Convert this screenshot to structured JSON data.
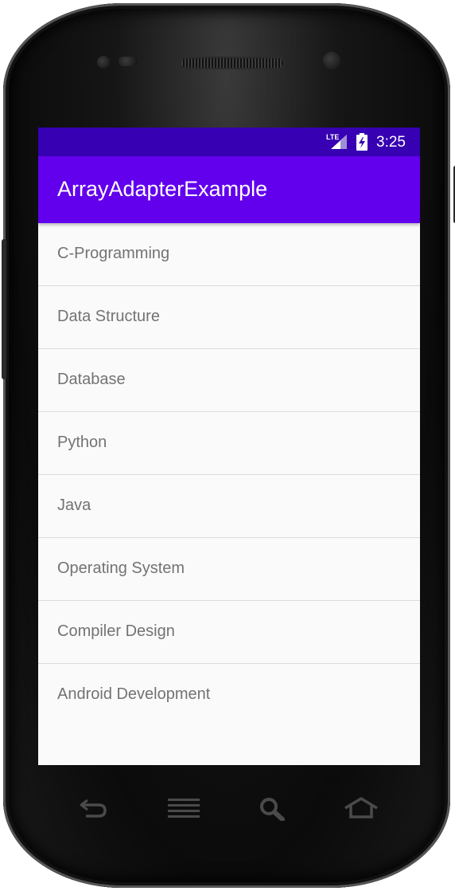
{
  "status_bar": {
    "network": "LTE",
    "time": "3:25"
  },
  "app_bar": {
    "title": "ArrayAdapterExample"
  },
  "list": {
    "items": [
      "C-Programming",
      "Data Structure",
      "Database",
      "Python",
      "Java",
      "Operating System",
      "Compiler Design",
      "Android Development"
    ]
  },
  "nav_bar": {
    "icons": [
      "back-icon",
      "menu-icon",
      "search-icon",
      "home-icon"
    ]
  },
  "colors": {
    "status_bar": "#3700b3",
    "app_bar": "#6200ee",
    "list_background": "#fafafa",
    "item_text": "#737373"
  }
}
